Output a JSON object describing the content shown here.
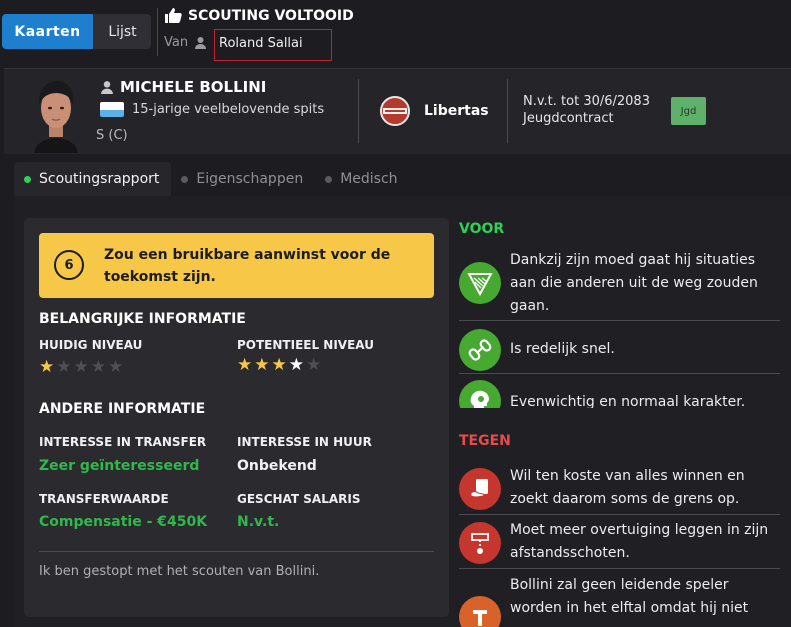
{
  "topbar": {
    "view_toggle": {
      "cards_label": "Kaarten",
      "list_label": "Lijst"
    },
    "scouting_title": "SCOUTING VOLTOOID",
    "from_label": "Van",
    "scout_name": "Roland Sallai"
  },
  "player": {
    "name": "MICHELE BOLLINI",
    "description": "15-jarige veelbelovende spits",
    "position": "S (C)",
    "club": "Libertas",
    "contract_line1": "N.v.t. tot 30/6/2083",
    "contract_line2": "Jeugdcontract",
    "contract_badge": "Jgd",
    "flag_colors": [
      "#ffffff",
      "#5ab2e8"
    ]
  },
  "tabs": [
    {
      "label": "Scoutingsrapport",
      "active": true
    },
    {
      "label": "Eigenschappen",
      "active": false
    },
    {
      "label": "Medisch",
      "active": false
    }
  ],
  "report": {
    "recommendation_score": "6",
    "recommendation_text": "Zou een bruikbare aanwinst voor de toekomst zijn.",
    "key_info_title": "BELANGRIJKE INFORMATIE",
    "current_ability_label": "HUIDIG NIVEAU",
    "current_ability_stars": 1,
    "potential_ability_label": "POTENTIEEL NIVEAU",
    "potential_ability_stars": 3.5,
    "stars_max": 5,
    "other_info_title": "ANDERE INFORMATIE",
    "transfer_interest_label": "INTERESSE IN TRANSFER",
    "transfer_interest_value": "Zeer geïnteresseerd",
    "loan_interest_label": "INTERESSE IN HUUR",
    "loan_interest_value": "Onbekend",
    "transfer_value_label": "TRANSFERWAARDE",
    "transfer_value_value": "Compensatie - €450K",
    "wage_label": "GESCHAT SALARIS",
    "wage_value": "N.v.t.",
    "footer_note": "Ik ben gestopt met het scouten van Bollini."
  },
  "pros": {
    "title": "VOOR",
    "items": [
      {
        "icon": "shield-net-icon",
        "text": "Dankzij zijn moed gaat hij situaties aan die anderen uit de weg zouden gaan."
      },
      {
        "icon": "chain-link-icon",
        "text": "Is redelijk snel."
      },
      {
        "icon": "head-mind-icon",
        "text": "Evenwichtig en normaal karakter."
      }
    ]
  },
  "cons": {
    "title": "TEGEN",
    "items": [
      {
        "icon": "card-hand-icon",
        "text": "Wil ten koste van alles winnen en zoekt daarom soms de grens op."
      },
      {
        "icon": "shooting-goal-icon",
        "text": "Moet meer overtuiging leggen in zijn afstandsschoten."
      },
      {
        "icon": "leadership-icon",
        "text": "Bollini zal geen leidende speler worden in het elftal omdat hij niet"
      }
    ]
  },
  "colors": {
    "accent_blue": "#1f7fcf",
    "callout_yellow": "#f7c748",
    "positive_green": "#2fd157",
    "negative_red": "#e84b4b"
  }
}
